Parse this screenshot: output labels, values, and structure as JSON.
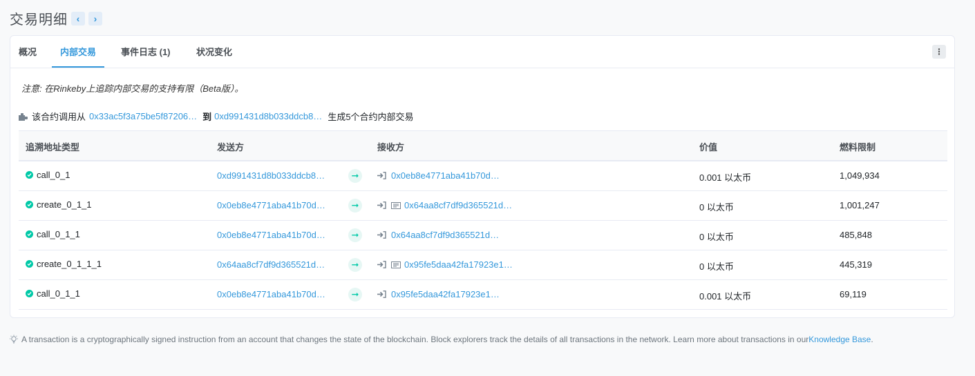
{
  "page_title": "交易明细",
  "tabs": [
    {
      "label": "概况",
      "active": false
    },
    {
      "label": "内部交易",
      "active": true
    },
    {
      "label": "事件日志 (1)",
      "active": false
    },
    {
      "label": "状况变化",
      "active": false
    }
  ],
  "note": "注意: 在Rinkeby上追踪内部交易的支持有限（Beta版）。",
  "summary": {
    "prefix": "该合约调用从",
    "from": "0x33ac5f3a75be5f87206…",
    "to_label": "到",
    "to": "0xd991431d8b033ddcb8…",
    "suffix": "生成5个合约内部交易"
  },
  "table": {
    "headers": [
      "追溯地址类型",
      "发送方",
      "接收方",
      "价值",
      "燃料限制"
    ],
    "rows": [
      {
        "type": "call_0_1",
        "from": "0xd991431d8b033ddcb8…",
        "to": "0x0eb8e4771aba41b70d…",
        "contract": false,
        "value": "0.001 以太币",
        "gas": "1,049,934"
      },
      {
        "type": "create_0_1_1",
        "from": "0x0eb8e4771aba41b70d…",
        "to": "0x64aa8cf7df9d365521d…",
        "contract": true,
        "value": "0 以太币",
        "gas": "1,001,247"
      },
      {
        "type": "call_0_1_1",
        "from": "0x0eb8e4771aba41b70d…",
        "to": "0x64aa8cf7df9d365521d…",
        "contract": false,
        "value": "0 以太币",
        "gas": "485,848"
      },
      {
        "type": "create_0_1_1_1",
        "from": "0x64aa8cf7df9d365521d…",
        "to": "0x95fe5daa42fa17923e1…",
        "contract": true,
        "value": "0 以太币",
        "gas": "445,319"
      },
      {
        "type": "call_0_1_1",
        "from": "0x0eb8e4771aba41b70d…",
        "to": "0x95fe5daa42fa17923e1…",
        "contract": false,
        "value": "0.001 以太币",
        "gas": "69,119"
      }
    ]
  },
  "footer": {
    "text": "A transaction is a cryptographically signed instruction from an account that changes the state of the blockchain. Block explorers track the details of all transactions in the network. Learn more about transactions in our ",
    "link": "Knowledge Base",
    "end": "."
  },
  "icons": {
    "nav_prev": "chevron-left-icon",
    "nav_next": "chevron-right-icon",
    "more": "more-vertical-icon",
    "status": "check-circle-icon",
    "transfer": "arrow-right-icon",
    "receiver": "sign-in-icon",
    "contract": "contract-icon",
    "tip": "lightbulb-icon"
  },
  "colors": {
    "accent": "#3498db",
    "success": "#00c9a7"
  }
}
